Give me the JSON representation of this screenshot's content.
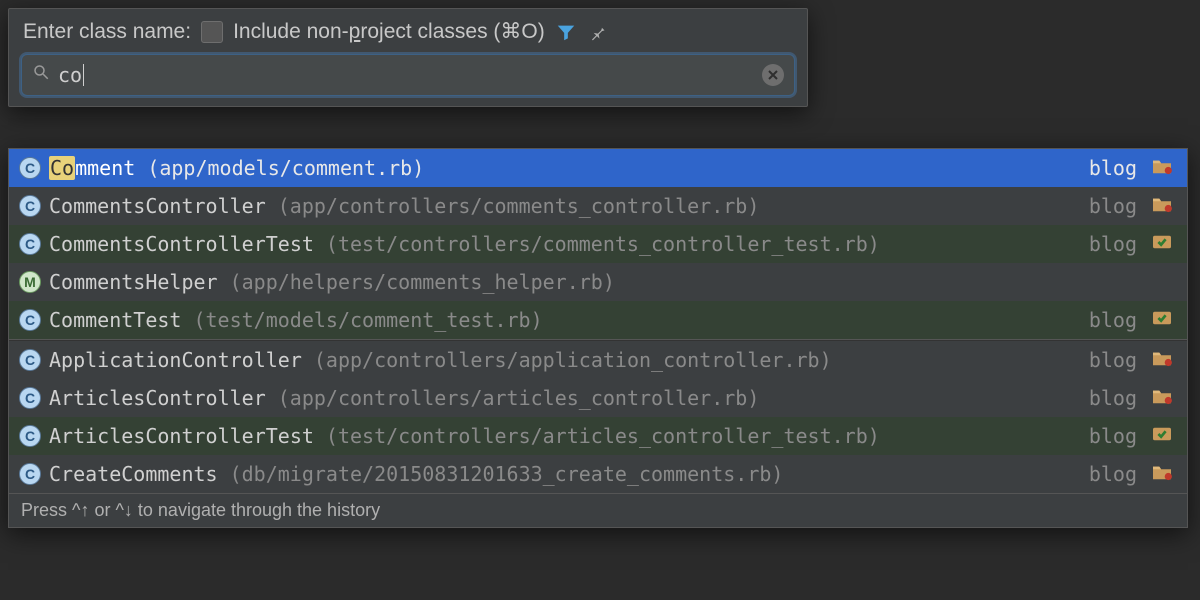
{
  "header": {
    "label_prefix": "Enter class name:",
    "include_label_pre": "Include non-",
    "include_label_underlined": "p",
    "include_label_post": "roject classes (⌘O)"
  },
  "search": {
    "query": "co",
    "placeholder": ""
  },
  "results_primary": [
    {
      "badge": "C",
      "name_pre": "",
      "name_match": "Co",
      "name_post": "mment",
      "path": "(app/models/comment.rb)",
      "module": "blog",
      "right_icon": "folder",
      "selected": true,
      "test": false
    },
    {
      "badge": "C",
      "name_pre": "",
      "name_match": "",
      "name_post": "CommentsController",
      "path": "(app/controllers/comments_controller.rb)",
      "module": "blog",
      "right_icon": "folder",
      "selected": false,
      "test": false
    },
    {
      "badge": "C",
      "name_pre": "",
      "name_match": "",
      "name_post": "CommentsControllerTest",
      "path": "(test/controllers/comments_controller_test.rb)",
      "module": "blog",
      "right_icon": "test",
      "selected": false,
      "test": true
    },
    {
      "badge": "M",
      "name_pre": "",
      "name_match": "",
      "name_post": "CommentsHelper",
      "path": "(app/helpers/comments_helper.rb)",
      "module": "",
      "right_icon": "",
      "selected": false,
      "test": false
    },
    {
      "badge": "C",
      "name_pre": "",
      "name_match": "",
      "name_post": "CommentTest",
      "path": "(test/models/comment_test.rb)",
      "module": "blog",
      "right_icon": "test",
      "selected": false,
      "test": true
    }
  ],
  "results_secondary": [
    {
      "badge": "C",
      "name_post": "ApplicationController",
      "path": "(app/controllers/application_controller.rb)",
      "module": "blog",
      "right_icon": "folder",
      "test": false
    },
    {
      "badge": "C",
      "name_post": "ArticlesController",
      "path": "(app/controllers/articles_controller.rb)",
      "module": "blog",
      "right_icon": "folder",
      "test": false
    },
    {
      "badge": "C",
      "name_post": "ArticlesControllerTest",
      "path": "(test/controllers/articles_controller_test.rb)",
      "module": "blog",
      "right_icon": "test",
      "test": true
    },
    {
      "badge": "C",
      "name_post": "CreateComments",
      "path": "(db/migrate/20150831201633_create_comments.rb)",
      "module": "blog",
      "right_icon": "folder",
      "test": false
    }
  ],
  "hint": "Press ^↑ or ^↓ to navigate through the history"
}
